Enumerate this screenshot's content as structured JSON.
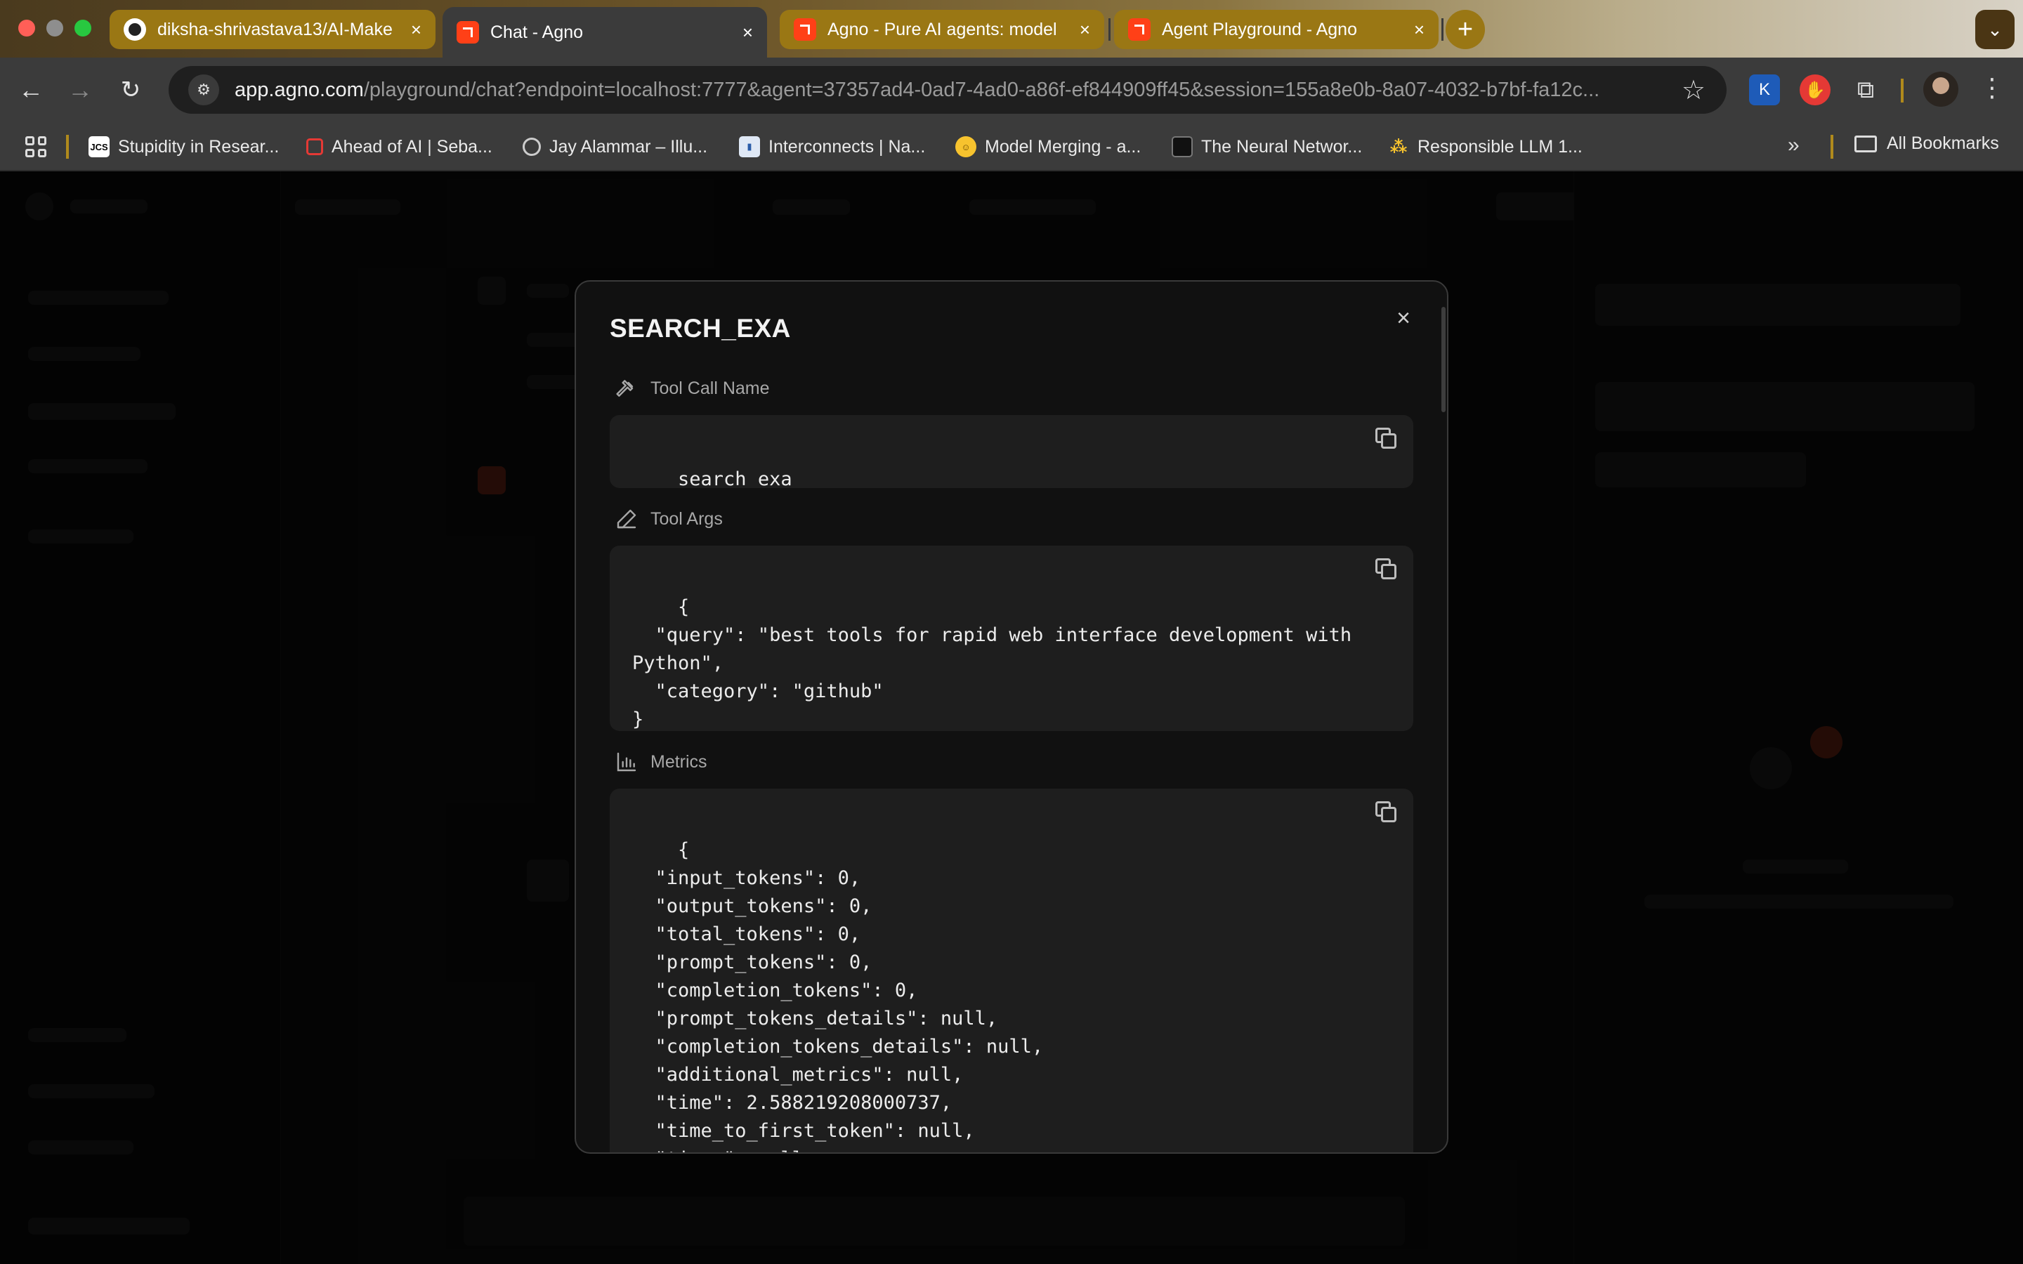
{
  "browser": {
    "tabs": [
      {
        "label": "diksha-shrivastava13/AI-Make",
        "favicon": "github-icon",
        "active": false
      },
      {
        "label": "Chat - Agno",
        "favicon": "agno-icon",
        "active": true
      },
      {
        "label": "Agno - Pure AI agents: model",
        "favicon": "agno-icon",
        "active": false
      },
      {
        "label": "Agent Playground - Agno",
        "favicon": "agno-icon",
        "active": false
      }
    ],
    "new_tab": "+",
    "tab_close": "×",
    "url_host": "app.agno.com",
    "url_rest": "/playground/chat?endpoint=localhost:7777&agent=37357ad4-0ad7-4ad0-a86f-ef844909ff45&session=155a8e0b-8a07-4032-b7bf-fa12c...",
    "bookmarks": [
      {
        "label": "Stupidity in Resear...",
        "icon": "JCS"
      },
      {
        "label": "Ahead of AI | Seba...",
        "icon": ""
      },
      {
        "label": "Jay Alammar – Illu...",
        "icon": ""
      },
      {
        "label": "Interconnects | Na...",
        "icon": ""
      },
      {
        "label": "Model Merging - a...",
        "icon": ""
      },
      {
        "label": "The Neural Networ...",
        "icon": ""
      },
      {
        "label": "Responsible LLM 1...",
        "icon": ""
      }
    ],
    "bookmarks_more": "»",
    "all_bookmarks": "All Bookmarks"
  },
  "modal": {
    "title": "SEARCH_EXA",
    "close": "×",
    "sections": {
      "tool_call_name": {
        "heading": "Tool Call Name",
        "value": "search_exa"
      },
      "tool_args": {
        "heading": "Tool Args",
        "value": "{\n  \"query\": \"best tools for rapid web interface development with\nPython\",\n  \"category\": \"github\"\n}"
      },
      "metrics": {
        "heading": "Metrics",
        "value": "{\n  \"input_tokens\": 0,\n  \"output_tokens\": 0,\n  \"total_tokens\": 0,\n  \"prompt_tokens\": 0,\n  \"completion_tokens\": 0,\n  \"prompt_tokens_details\": null,\n  \"completion_tokens_details\": null,\n  \"additional_metrics\": null,\n  \"time\": 2.588219208000737,\n  \"time_to_first_token\": null,\n  \"timer\": null\n}"
      }
    }
  },
  "colors": {
    "agno_brand": "#ff4017",
    "tab_gold": "#9a7714",
    "modal_bg": "#111111",
    "code_bg": "#1e1e1e"
  }
}
